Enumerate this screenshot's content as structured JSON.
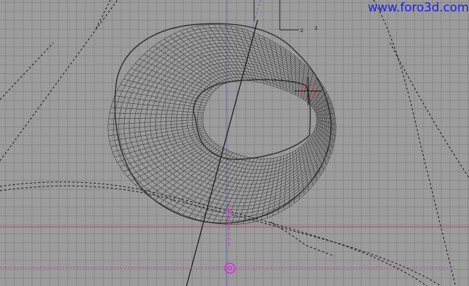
{
  "viewport": {
    "watermark": "www.foro3d.com",
    "axis_labels": [
      "z",
      "z"
    ]
  },
  "colors": {
    "background": "#9c9c9c",
    "grid": "#7f7f7f",
    "mesh_wire": "#3d3d3d",
    "x_axis_line": "#b04a4a",
    "y_axis_line": "#6a6ab0",
    "pivot_line": "#ff00ff",
    "cursor_ring": "#ff3030",
    "watermark": "#1a1aff"
  },
  "icons": [
    "3d-cursor-icon",
    "object-origin-icon",
    "pivot-center-icon"
  ]
}
